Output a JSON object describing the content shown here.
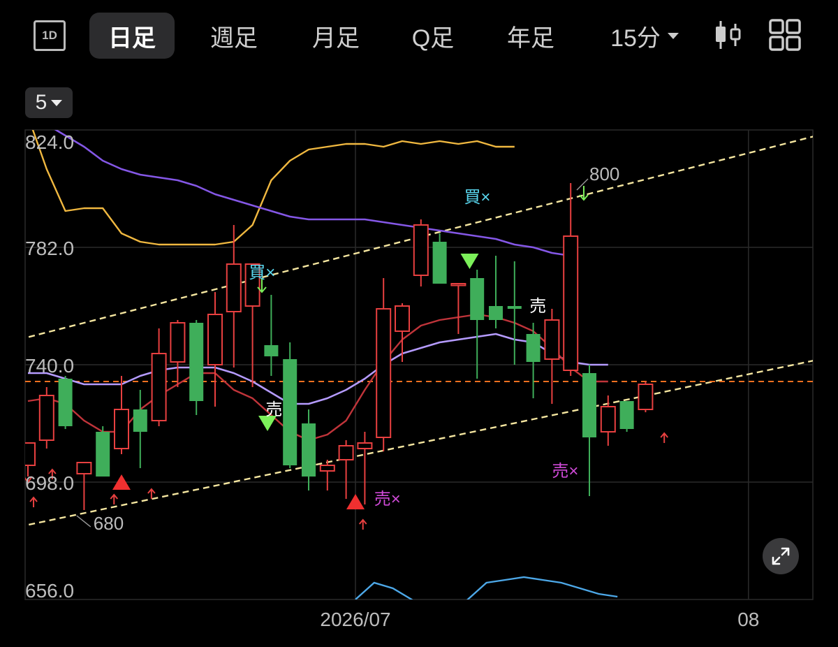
{
  "toolbar": {
    "interval_icon_label": "1D",
    "tabs": [
      "日足",
      "週足",
      "月足",
      "Q足",
      "年足"
    ],
    "active_tab": "日足",
    "minute_select": "15分",
    "chart_type_icon": "candlestick-icon",
    "layout_icon": "grid-layout-icon"
  },
  "period_select": "5",
  "colors": {
    "up": "#e84040",
    "down": "#3fae5a",
    "ma_short": "#c0343a",
    "ma_mid": "#b59bff",
    "ma_long": "#8457e6",
    "bollinger": "#f0b840",
    "channel": "#f5e6a0",
    "price_line": "#f07020",
    "lower_band": "#4da8e8",
    "buy_signal": "#7cf05a",
    "sell_signal": "#f03030",
    "label_buy": "#5ad8f0",
    "label_sell": "#d04ad8"
  },
  "chart_data": {
    "type": "candlestick",
    "y_ticks": [
      "824.0",
      "782.0",
      "740.0",
      "698.0",
      "656.0"
    ],
    "ylim": [
      656,
      824
    ],
    "x_ticks": [
      {
        "label": "2026/07",
        "index": 17.5
      },
      {
        "label": "08",
        "index": 38.5
      }
    ],
    "current_price": 734,
    "candles": [
      {
        "o": 704,
        "h": 708,
        "l": 700,
        "c": 712
      },
      {
        "o": 713,
        "h": 732,
        "l": 710,
        "c": 729
      },
      {
        "o": 735,
        "h": 736,
        "l": 717,
        "c": 718
      },
      {
        "o": 701,
        "h": 703,
        "l": 688,
        "c": 705
      },
      {
        "o": 716,
        "h": 718,
        "l": 701,
        "c": 700
      },
      {
        "o": 710,
        "h": 736,
        "l": 708,
        "c": 724
      },
      {
        "o": 724,
        "h": 731,
        "l": 703,
        "c": 716
      },
      {
        "o": 720,
        "h": 753,
        "l": 718,
        "c": 744
      },
      {
        "o": 741,
        "h": 756,
        "l": 732,
        "c": 755
      },
      {
        "o": 755,
        "h": 756,
        "l": 722,
        "c": 727
      },
      {
        "o": 740,
        "h": 766,
        "l": 725,
        "c": 758
      },
      {
        "o": 759,
        "h": 790,
        "l": 739,
        "c": 776
      },
      {
        "o": 761,
        "h": 772,
        "l": 732,
        "c": 776
      },
      {
        "o": 747,
        "h": 765,
        "l": 736,
        "c": 743
      },
      {
        "o": 742,
        "h": 748,
        "l": 703,
        "c": 704
      },
      {
        "o": 719,
        "h": 724,
        "l": 695,
        "c": 700
      },
      {
        "o": 702,
        "h": 706,
        "l": 695,
        "c": 704
      },
      {
        "o": 706,
        "h": 713,
        "l": 692,
        "c": 711
      },
      {
        "o": 710,
        "h": 716,
        "l": 690,
        "c": 712
      },
      {
        "o": 714,
        "h": 771,
        "l": 709,
        "c": 760
      },
      {
        "o": 752,
        "h": 762,
        "l": 741,
        "c": 761
      },
      {
        "o": 772,
        "h": 792,
        "l": 768,
        "c": 790
      },
      {
        "o": 784,
        "h": 787,
        "l": 769,
        "c": 769
      },
      {
        "o": 769,
        "h": 769,
        "l": 751,
        "c": 769
      },
      {
        "o": 771,
        "h": 774,
        "l": 735,
        "c": 756
      },
      {
        "o": 761,
        "h": 779,
        "l": 753,
        "c": 756
      },
      {
        "o": 761,
        "h": 777,
        "l": 740,
        "c": 760
      },
      {
        "o": 751,
        "h": 755,
        "l": 728,
        "c": 741
      },
      {
        "o": 742,
        "h": 760,
        "l": 726,
        "c": 756
      },
      {
        "o": 738,
        "h": 805,
        "l": 736,
        "c": 786
      },
      {
        "o": 737,
        "h": 740,
        "l": 693,
        "c": 714
      },
      {
        "o": 716,
        "h": 729,
        "l": 711,
        "c": 725
      },
      {
        "o": 727,
        "h": 727,
        "l": 716,
        "c": 717
      },
      {
        "o": 724,
        "h": 734,
        "l": 723,
        "c": 733
      }
    ],
    "ma_short": [
      727,
      728,
      726,
      720,
      716,
      716,
      724,
      729,
      733,
      737,
      737,
      731,
      728,
      722,
      716,
      713,
      715,
      720,
      731,
      741,
      749,
      754,
      756,
      757,
      758,
      757,
      755,
      752,
      746,
      739,
      734,
      734
    ],
    "ma_mid": [
      737,
      737,
      735,
      733,
      733,
      733,
      736,
      738,
      739,
      739,
      739,
      737,
      734,
      730,
      726,
      726,
      728,
      731,
      735,
      740,
      744,
      746,
      748,
      749,
      750,
      751,
      749,
      748,
      744,
      741,
      740,
      740
    ],
    "ma_long": [
      829,
      826,
      822,
      818,
      813,
      810,
      808,
      807,
      806,
      804,
      801,
      799,
      797,
      795,
      793,
      792,
      792,
      792,
      792,
      791,
      790,
      789,
      788,
      787,
      786,
      785,
      783,
      782,
      780,
      779
    ],
    "bollinger_upper": [
      829,
      810,
      795,
      796,
      796,
      787,
      784,
      783,
      783,
      783,
      783,
      784,
      790,
      806,
      813,
      817,
      818,
      819,
      819,
      818,
      820,
      819,
      820,
      819,
      820,
      818,
      818
    ],
    "bollinger_lower": [
      656,
      662,
      660,
      656,
      651,
      650,
      656,
      662,
      663,
      664,
      663,
      662,
      660,
      658,
      657
    ],
    "channel_upper": {
      "from": [
        -0.5,
        749
      ],
      "to": [
        44.5,
        826
      ]
    },
    "channel_lower": {
      "from": [
        -0.5,
        682
      ],
      "to": [
        44.5,
        745
      ]
    },
    "annotations": [
      {
        "text": "買×",
        "index": 11.8,
        "price": 771,
        "kind": "buy"
      },
      {
        "text": "買×",
        "index": 23.3,
        "price": 798,
        "kind": "buy"
      },
      {
        "text": "売",
        "index": 12.7,
        "price": 722,
        "kind": "sell-plain"
      },
      {
        "text": "売",
        "index": 26.8,
        "price": 759,
        "kind": "sell-plain"
      },
      {
        "text": "売×",
        "index": 18.5,
        "price": 690,
        "kind": "sell"
      },
      {
        "text": "売×",
        "index": 28.0,
        "price": 700,
        "kind": "sell"
      },
      {
        "text": "800",
        "index": 30.0,
        "price": 806,
        "kind": "value"
      },
      {
        "text": "680",
        "index": 3.5,
        "price": 681,
        "kind": "value"
      }
    ],
    "buy_triangles": [
      {
        "index": 12.8,
        "price": 719
      },
      {
        "index": 23.6,
        "price": 777
      }
    ],
    "sell_triangles": [
      {
        "index": 5.0,
        "price": 698
      },
      {
        "index": 17.5,
        "price": 691
      }
    ],
    "up_arrows": [
      0.3,
      1.3,
      4.6,
      6.6,
      17.9,
      34.0
    ],
    "down_arrows": [
      12.5,
      29.7
    ],
    "wick_marks": [
      {
        "index": 0.0,
        "price": 698
      }
    ]
  }
}
